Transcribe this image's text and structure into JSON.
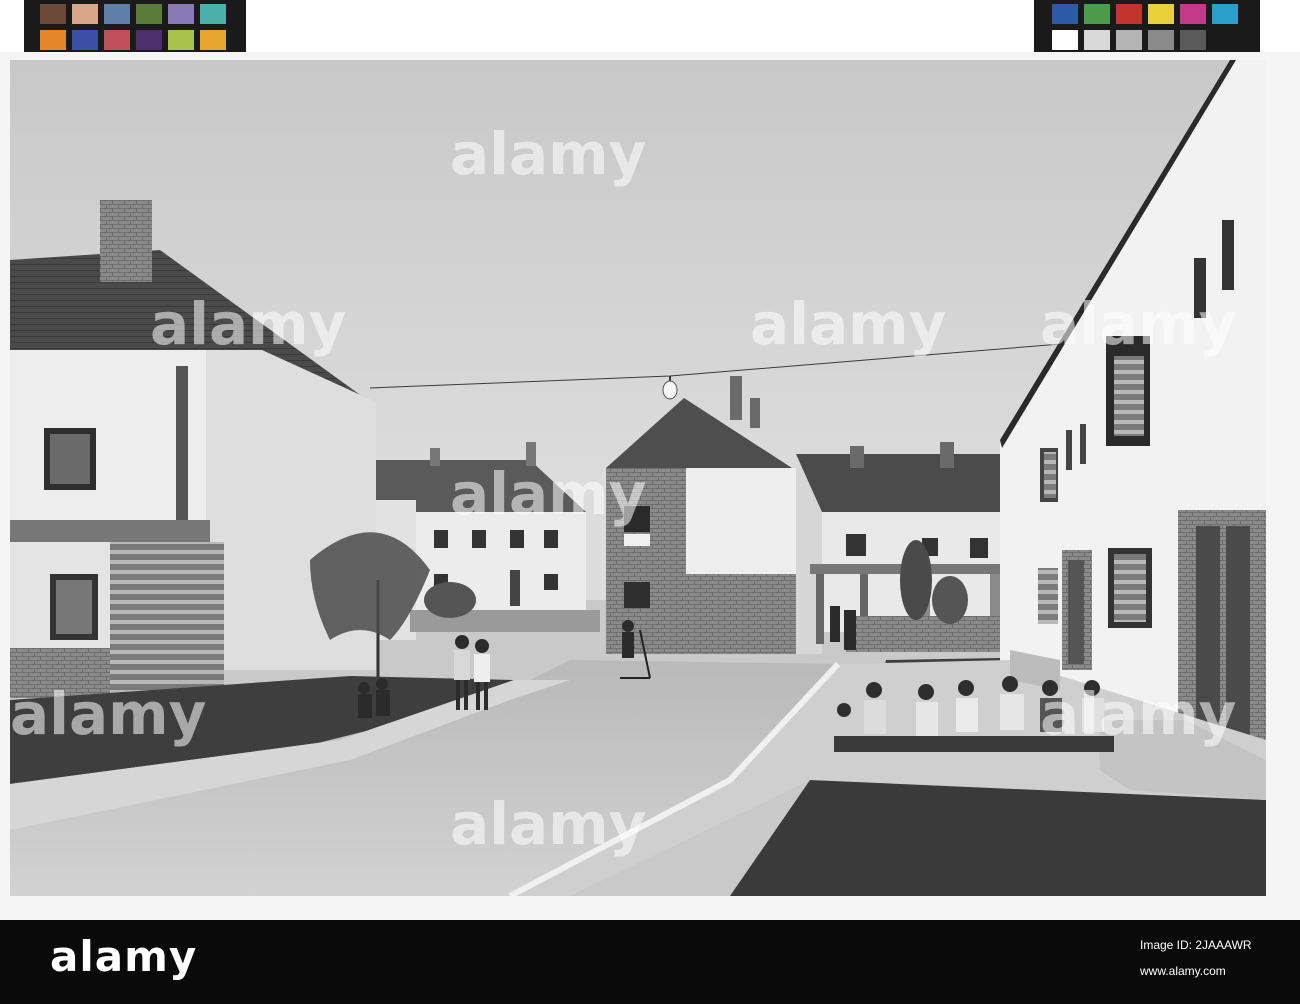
{
  "image": {
    "kind": "scanned black-and-white photograph",
    "subject": "housing estate street with children"
  },
  "footer": {
    "logo_text": "alamy",
    "image_id": "Image ID: 2JAAAWR",
    "url": "www.alamy.com"
  },
  "watermark": {
    "text": "alamy"
  },
  "color_targets": {
    "left": [
      "#6b4a3a",
      "#d9a58b",
      "#5f7fa8",
      "#5a7a3a",
      "#8a78b5",
      "#49b0a8",
      "#e6862a",
      "#3b4fa6",
      "#c14f5b",
      "#4e2f6e",
      "#a8c34a",
      "#e8a52b"
    ],
    "right": [
      "#2b5aa6",
      "#4c9a4a",
      "#c0342b",
      "#e8d03a",
      "#c33a8a",
      "#2aa0c8",
      "#ffffff",
      "#d9d9d9",
      "#b5b5b5",
      "#8a8a8a",
      "#5a5a5a",
      "#1a1a1a"
    ]
  }
}
